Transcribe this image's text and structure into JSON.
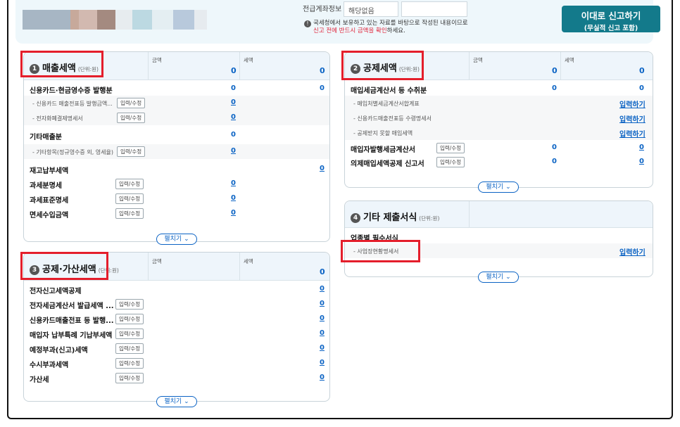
{
  "top": {
    "field_label": "전급계좌정보",
    "field_value": "해당없음",
    "notice_line1": "국세청에서 보유하고 있는 자료를 바탕으로 작성된 내용이므로",
    "notice_red": "신고 전에 반드시 금액을 확인",
    "notice_tail": "하세요.",
    "report_btn_line1": "이대로 신고하기",
    "report_btn_line2": "(무실적 신고 포함)"
  },
  "panel1": {
    "number": "1",
    "title": "매출세액",
    "unit": "(단위:원)",
    "col_amount": "금액",
    "col_tax": "세액",
    "head_amount": "0",
    "head_tax": "0",
    "rows": [
      {
        "label": "신용카드·현금영수증 발행분",
        "amount": "0",
        "tax": "0"
      },
      {
        "label": "- 신용카드 매출전표등 발행금액...",
        "btn": "입력/수정",
        "amount": "0"
      },
      {
        "label": "- 전자화폐결제명세서",
        "btn": "입력/수정",
        "amount": "0"
      },
      {
        "label": "기타매출분",
        "amount": "0"
      },
      {
        "label": "- 기타항목(정규영수증 외, 영세율)",
        "btn": "입력/수정",
        "amount": "0"
      },
      {
        "label": "재고납부세액",
        "tax": "0"
      },
      {
        "label": "과세분명세",
        "btn": "입력/수정",
        "amount": "0"
      },
      {
        "label": "과세표준명세",
        "btn": "입력/수정",
        "amount": "0"
      },
      {
        "label": "면세수입금액",
        "btn": "입력/수정",
        "amount": "0"
      }
    ],
    "expand": "펼치기"
  },
  "panel2": {
    "number": "2",
    "title": "공제세액",
    "unit": "(단위:원)",
    "col_amount": "금액",
    "col_tax": "세액",
    "head_amount": "0",
    "head_tax": "0",
    "rows": [
      {
        "label": "매입세금계산서 등 수취분",
        "amount": "0",
        "tax": "0"
      },
      {
        "label": "- 매입처별세금계산서합계표",
        "link": "입력하기"
      },
      {
        "label": "- 신용카드매출전표등 수령명세서",
        "link": "입력하기"
      },
      {
        "label": "- 공제받지 못할 매입세액",
        "link": "입력하기"
      },
      {
        "label": "매입자발행세금계산서",
        "btn": "입력/수정",
        "amount": "0",
        "tax": "0"
      },
      {
        "label": "의제매입세액공제 신고서",
        "btn": "입력/수정",
        "amount": "0",
        "tax": "0"
      }
    ],
    "expand": "펼치기"
  },
  "panel3": {
    "number": "3",
    "title": "공제·가산세액",
    "unit": "(단위:원)",
    "col_amount": "금액",
    "col_tax": "세액",
    "head_tax": "0",
    "rows": [
      {
        "label": "전자신고세액공제",
        "tax": "0"
      },
      {
        "label": "전자세금계산서 발급세액 ...",
        "btn": "입력/수정",
        "tax": "0"
      },
      {
        "label": "신용카드매출전표 등 발행...",
        "btn": "입력/수정",
        "tax": "0"
      },
      {
        "label": "매입자 납부특례 기납부세액",
        "btn": "입력/수정",
        "tax": "0"
      },
      {
        "label": "예정부과(신고)세액",
        "btn": "입력/수정",
        "tax": "0"
      },
      {
        "label": "수시부과세액",
        "btn": "입력/수정",
        "tax": "0"
      },
      {
        "label": "가산세",
        "btn": "입력/수정",
        "tax": "0"
      }
    ],
    "expand": "펼치기"
  },
  "panel4": {
    "number": "4",
    "title": "기타 제출서식",
    "unit": "(단위:원)",
    "section": "업종별 필수서식",
    "rows": [
      {
        "label": "- 사업장현황명세서",
        "link": "입력하기"
      }
    ],
    "expand": "펼치기"
  },
  "colors": {
    "accent": "#0b63c4",
    "report_btn": "#137a8b",
    "highlight": "#e41e2b"
  }
}
